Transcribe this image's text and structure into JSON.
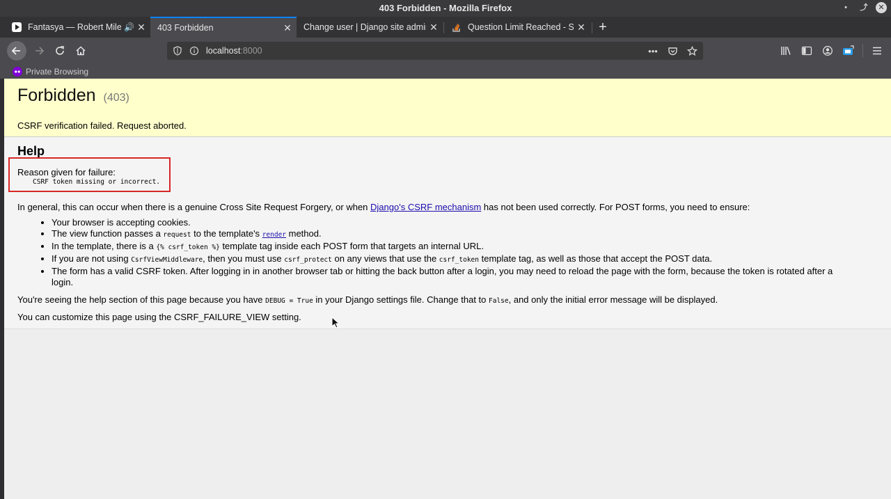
{
  "window": {
    "title": "403 Forbidden - Mozilla Firefox"
  },
  "tabs": [
    {
      "title": "Fantasya — Robert Miles",
      "active": false,
      "audio": true,
      "icon": "play-logo-icon"
    },
    {
      "title": "403 Forbidden",
      "active": true,
      "icon": ""
    },
    {
      "title": "Change user | Django site admin",
      "active": false,
      "icon": ""
    },
    {
      "title": "Question Limit Reached - Sta",
      "active": false,
      "icon": "stackoverflow-icon"
    }
  ],
  "urlbar": {
    "host": "localhost",
    "port": ":8000"
  },
  "private_browsing": {
    "label": "Private Browsing"
  },
  "page": {
    "title": "Forbidden",
    "code": "(403)",
    "message": "CSRF verification failed. Request aborted.",
    "help_heading": "Help",
    "reason_label": "Reason given for failure:",
    "reason_code": "CSRF token missing or incorrect.",
    "para1_before": "In general, this can occur when there is a genuine Cross Site Request Forgery, or when ",
    "para1_link": "Django's CSRF mechanism",
    "para1_after": " has not been used correctly. For POST forms, you need to ensure:",
    "bullet1": "Your browser is accepting cookies.",
    "bullet2_a": "The view function passes a ",
    "bullet2_code": "request",
    "bullet2_b": " to the template's ",
    "bullet2_link": "render",
    "bullet2_c": " method.",
    "bullet3_a": "In the template, there is a ",
    "bullet3_code": "{% csrf_token %}",
    "bullet3_b": " template tag inside each POST form that targets an internal URL.",
    "bullet4_a": "If you are not using ",
    "bullet4_code1": "CsrfViewMiddleware",
    "bullet4_b": ", then you must use ",
    "bullet4_code2": "csrf_protect",
    "bullet4_c": " on any views that use the ",
    "bullet4_code3": "csrf_token",
    "bullet4_d": " template tag, as well as those that accept the POST data.",
    "bullet5": "The form has a valid CSRF token. After logging in in another browser tab or hitting the back button after a login, you may need to reload the page with the form, because the token is rotated after a login.",
    "para2_a": "You're seeing the help section of this page because you have ",
    "para2_code1": "DEBUG = True",
    "para2_b": " in your Django settings file. Change that to ",
    "para2_code2": "False",
    "para2_c": ", and only the initial error message will be displayed.",
    "para3": "You can customize this page using the CSRF_FAILURE_VIEW setting."
  },
  "colors": {
    "accent": "#0a84ff",
    "summary_bg": "#ffffcc",
    "highlight_box": "#d92626",
    "private": "#8000d7"
  }
}
